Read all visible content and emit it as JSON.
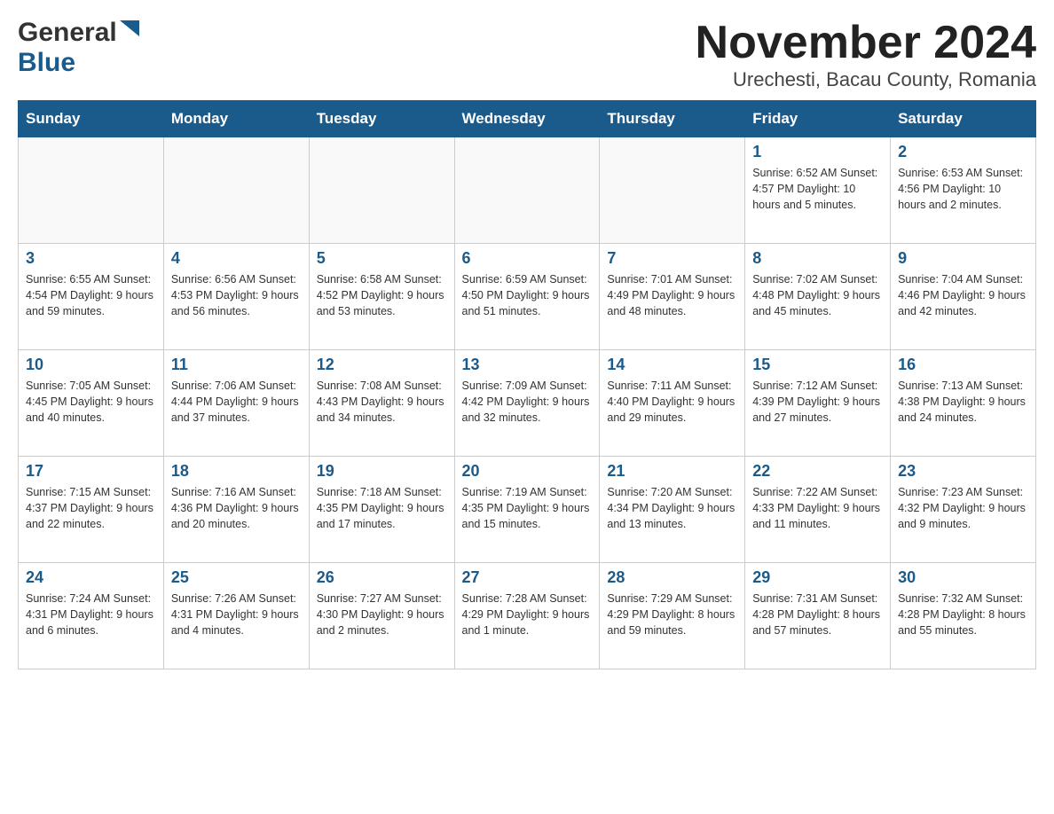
{
  "header": {
    "logo_general": "General",
    "logo_blue": "Blue",
    "month_title": "November 2024",
    "location": "Urechesti, Bacau County, Romania"
  },
  "weekdays": [
    "Sunday",
    "Monday",
    "Tuesday",
    "Wednesday",
    "Thursday",
    "Friday",
    "Saturday"
  ],
  "weeks": [
    {
      "days": [
        {
          "number": "",
          "info": ""
        },
        {
          "number": "",
          "info": ""
        },
        {
          "number": "",
          "info": ""
        },
        {
          "number": "",
          "info": ""
        },
        {
          "number": "",
          "info": ""
        },
        {
          "number": "1",
          "info": "Sunrise: 6:52 AM\nSunset: 4:57 PM\nDaylight: 10 hours\nand 5 minutes."
        },
        {
          "number": "2",
          "info": "Sunrise: 6:53 AM\nSunset: 4:56 PM\nDaylight: 10 hours\nand 2 minutes."
        }
      ]
    },
    {
      "days": [
        {
          "number": "3",
          "info": "Sunrise: 6:55 AM\nSunset: 4:54 PM\nDaylight: 9 hours\nand 59 minutes."
        },
        {
          "number": "4",
          "info": "Sunrise: 6:56 AM\nSunset: 4:53 PM\nDaylight: 9 hours\nand 56 minutes."
        },
        {
          "number": "5",
          "info": "Sunrise: 6:58 AM\nSunset: 4:52 PM\nDaylight: 9 hours\nand 53 minutes."
        },
        {
          "number": "6",
          "info": "Sunrise: 6:59 AM\nSunset: 4:50 PM\nDaylight: 9 hours\nand 51 minutes."
        },
        {
          "number": "7",
          "info": "Sunrise: 7:01 AM\nSunset: 4:49 PM\nDaylight: 9 hours\nand 48 minutes."
        },
        {
          "number": "8",
          "info": "Sunrise: 7:02 AM\nSunset: 4:48 PM\nDaylight: 9 hours\nand 45 minutes."
        },
        {
          "number": "9",
          "info": "Sunrise: 7:04 AM\nSunset: 4:46 PM\nDaylight: 9 hours\nand 42 minutes."
        }
      ]
    },
    {
      "days": [
        {
          "number": "10",
          "info": "Sunrise: 7:05 AM\nSunset: 4:45 PM\nDaylight: 9 hours\nand 40 minutes."
        },
        {
          "number": "11",
          "info": "Sunrise: 7:06 AM\nSunset: 4:44 PM\nDaylight: 9 hours\nand 37 minutes."
        },
        {
          "number": "12",
          "info": "Sunrise: 7:08 AM\nSunset: 4:43 PM\nDaylight: 9 hours\nand 34 minutes."
        },
        {
          "number": "13",
          "info": "Sunrise: 7:09 AM\nSunset: 4:42 PM\nDaylight: 9 hours\nand 32 minutes."
        },
        {
          "number": "14",
          "info": "Sunrise: 7:11 AM\nSunset: 4:40 PM\nDaylight: 9 hours\nand 29 minutes."
        },
        {
          "number": "15",
          "info": "Sunrise: 7:12 AM\nSunset: 4:39 PM\nDaylight: 9 hours\nand 27 minutes."
        },
        {
          "number": "16",
          "info": "Sunrise: 7:13 AM\nSunset: 4:38 PM\nDaylight: 9 hours\nand 24 minutes."
        }
      ]
    },
    {
      "days": [
        {
          "number": "17",
          "info": "Sunrise: 7:15 AM\nSunset: 4:37 PM\nDaylight: 9 hours\nand 22 minutes."
        },
        {
          "number": "18",
          "info": "Sunrise: 7:16 AM\nSunset: 4:36 PM\nDaylight: 9 hours\nand 20 minutes."
        },
        {
          "number": "19",
          "info": "Sunrise: 7:18 AM\nSunset: 4:35 PM\nDaylight: 9 hours\nand 17 minutes."
        },
        {
          "number": "20",
          "info": "Sunrise: 7:19 AM\nSunset: 4:35 PM\nDaylight: 9 hours\nand 15 minutes."
        },
        {
          "number": "21",
          "info": "Sunrise: 7:20 AM\nSunset: 4:34 PM\nDaylight: 9 hours\nand 13 minutes."
        },
        {
          "number": "22",
          "info": "Sunrise: 7:22 AM\nSunset: 4:33 PM\nDaylight: 9 hours\nand 11 minutes."
        },
        {
          "number": "23",
          "info": "Sunrise: 7:23 AM\nSunset: 4:32 PM\nDaylight: 9 hours\nand 9 minutes."
        }
      ]
    },
    {
      "days": [
        {
          "number": "24",
          "info": "Sunrise: 7:24 AM\nSunset: 4:31 PM\nDaylight: 9 hours\nand 6 minutes."
        },
        {
          "number": "25",
          "info": "Sunrise: 7:26 AM\nSunset: 4:31 PM\nDaylight: 9 hours\nand 4 minutes."
        },
        {
          "number": "26",
          "info": "Sunrise: 7:27 AM\nSunset: 4:30 PM\nDaylight: 9 hours\nand 2 minutes."
        },
        {
          "number": "27",
          "info": "Sunrise: 7:28 AM\nSunset: 4:29 PM\nDaylight: 9 hours\nand 1 minute."
        },
        {
          "number": "28",
          "info": "Sunrise: 7:29 AM\nSunset: 4:29 PM\nDaylight: 8 hours\nand 59 minutes."
        },
        {
          "number": "29",
          "info": "Sunrise: 7:31 AM\nSunset: 4:28 PM\nDaylight: 8 hours\nand 57 minutes."
        },
        {
          "number": "30",
          "info": "Sunrise: 7:32 AM\nSunset: 4:28 PM\nDaylight: 8 hours\nand 55 minutes."
        }
      ]
    }
  ]
}
